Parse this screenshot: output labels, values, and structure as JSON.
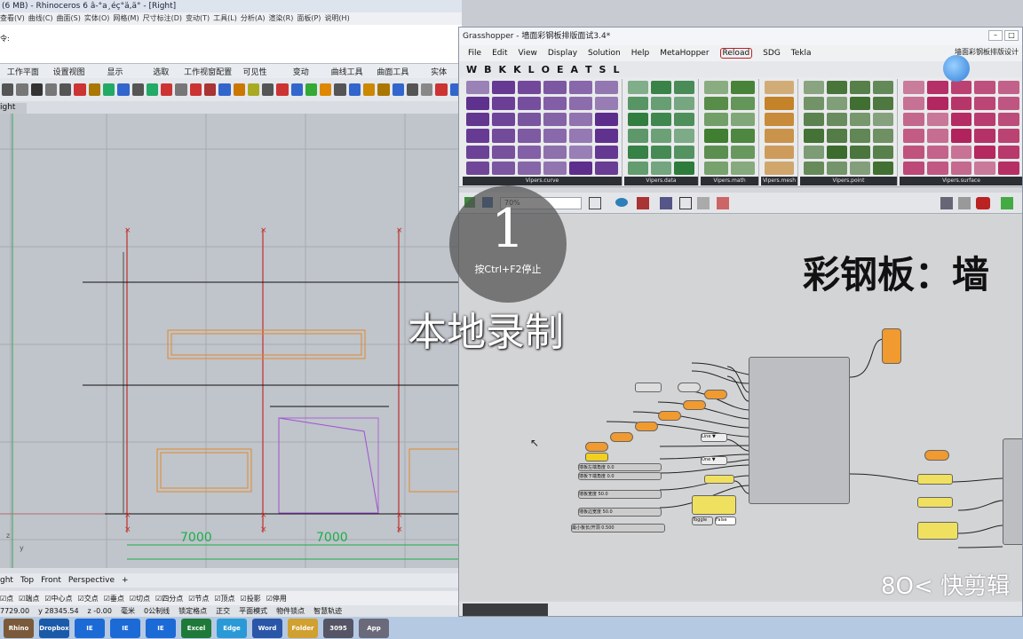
{
  "rhino": {
    "title": "(6 MB) - Rhinoceros 6 â-°a¸éç°ä,ä° - [Right]",
    "menu": [
      "查看(V)",
      "曲线(C)",
      "曲面(S)",
      "实体(O)",
      "网格(M)",
      "尺寸标注(D)",
      "变动(T)",
      "工具(L)",
      "分析(A)",
      "渲染(R)",
      "面板(P)",
      "说明(H)"
    ],
    "cmd_text": "令:",
    "tabs": [
      "工作平面",
      "设置视图",
      "显示",
      "选取",
      "工作视窗配置",
      "可见性",
      "变动",
      "曲线工具",
      "曲面工具",
      "实体"
    ],
    "viewport_label": "ight",
    "dim1": "7000",
    "dim2": "7000",
    "vp_tabs": [
      "ght",
      "Top",
      "Front",
      "Perspective",
      "+"
    ],
    "osnaps": [
      "点",
      "端点",
      "中心点",
      "交点",
      "垂点",
      "切点",
      "四分点",
      "节点",
      "顶点",
      "投影",
      "停用"
    ],
    "status": [
      "7729.00",
      "y 28345.54",
      "z -0.00",
      "毫米",
      "0公制线",
      "锁定格点",
      "正交",
      "平面模式",
      "物件锁点",
      "智慧轨迹"
    ]
  },
  "grasshopper": {
    "title": "Grasshopper - 墙面彩钢板排版面试3.4*",
    "menu": [
      "File",
      "Edit",
      "View",
      "Display",
      "Solution",
      "Help",
      "MetaHopper",
      "Reload",
      "SDG",
      "Tekla"
    ],
    "component_name": "墙面彩钢板排版设计",
    "tabs": [
      "W",
      "B",
      "K",
      "K",
      "L",
      "O",
      "E",
      "A",
      "T",
      "S",
      "L"
    ],
    "groups": [
      "Vipers.curve",
      "Vipers.data",
      "Vipers.math",
      "Vipers.mesh",
      "Vipers.point",
      "Vipers.surface"
    ],
    "zoom": "70%",
    "canvas_title": "彩钢板：墙",
    "inputs": [
      "墙板左端角度",
      "墙板下端角度",
      "墙板宽度",
      "墙板边宽度",
      "最小板长/开洞"
    ],
    "values": [
      "0.0",
      "0.0",
      "50.0",
      "50.0",
      "0.500"
    ],
    "dropdowns": [
      "Line",
      "One"
    ],
    "toggle": "Toggle",
    "toggle_val": "False"
  },
  "overlay": {
    "rec_number": "1",
    "rec_hint": "按Ctrl+F2停止",
    "rec_local": "本地录制",
    "watermark": "快剪辑"
  },
  "taskbar": {
    "items": [
      "Rhino",
      "Dropbox",
      "IE",
      "IE",
      "IE",
      "Excel",
      "Edge",
      "Word",
      "Folder",
      "3095",
      "App"
    ]
  },
  "colors": {
    "red_line": "#c0302a",
    "orange": "#e08a2a",
    "purple": "#a050d0",
    "green_dim": "#18b048",
    "gh_orange": "#f09a30"
  }
}
